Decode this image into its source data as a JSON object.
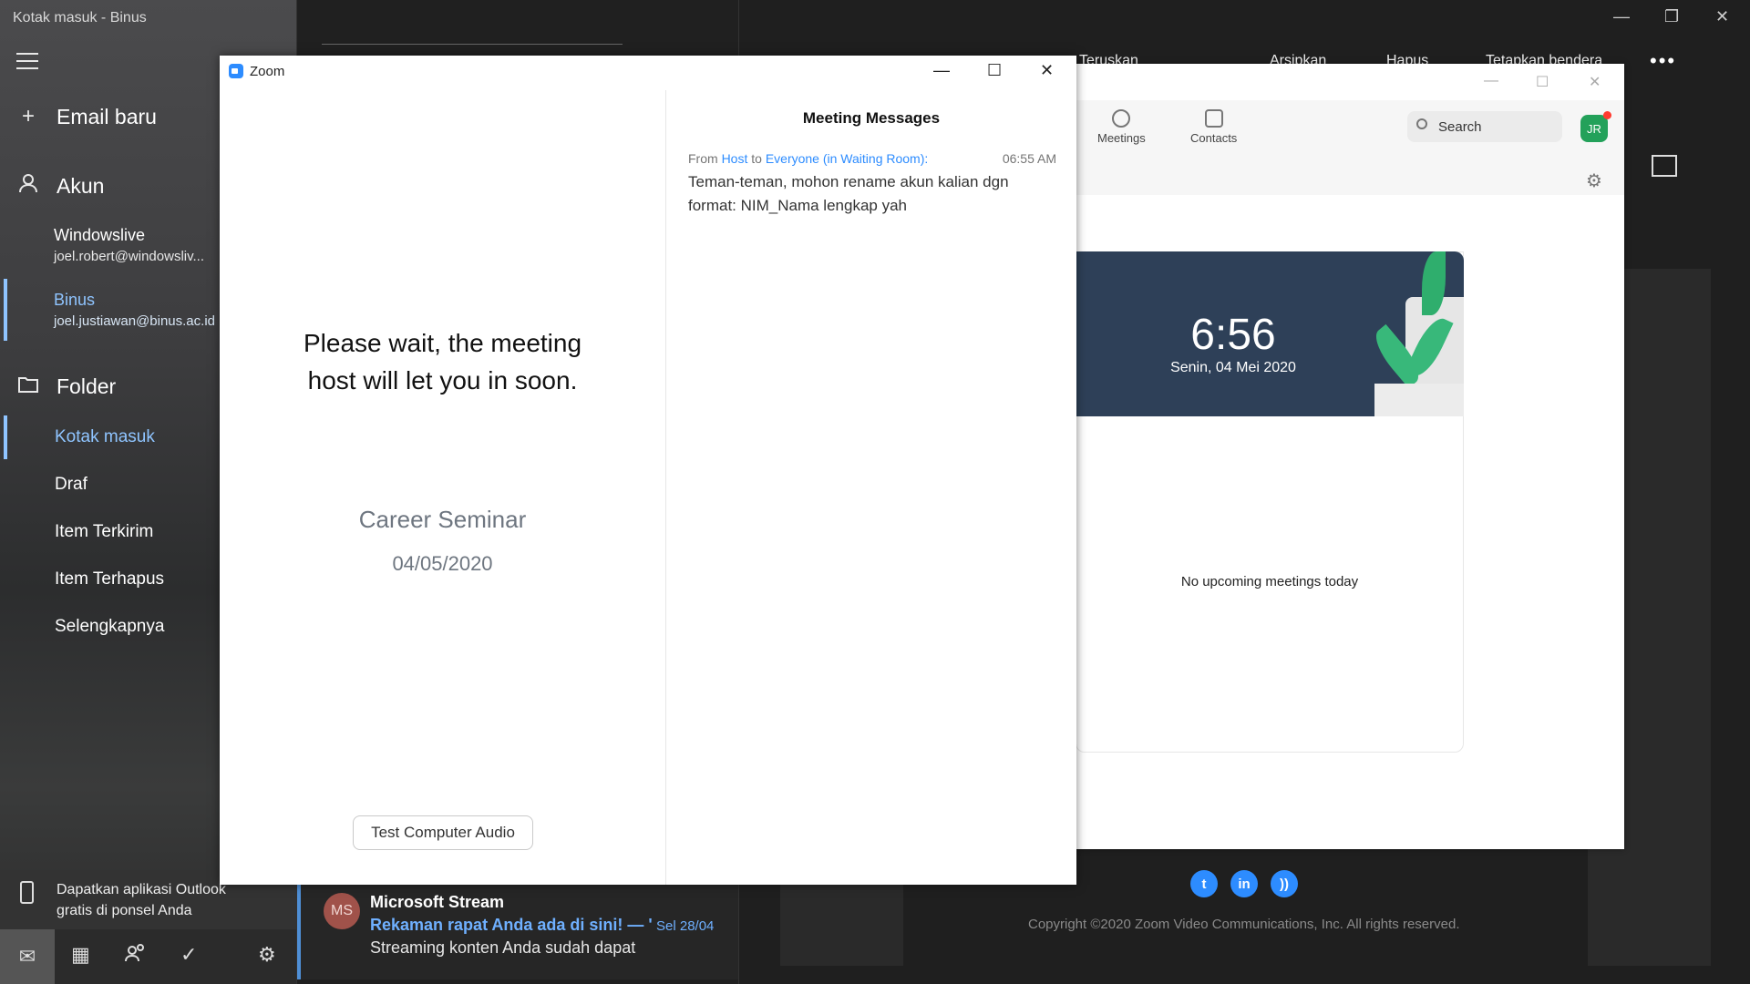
{
  "mail": {
    "window_title": "Kotak masuk - Binus",
    "new_email": "Email baru",
    "accounts_header": "Akun",
    "accounts": [
      {
        "name": "Windowslive",
        "email": "joel.robert@windowsliv..."
      },
      {
        "name": "Binus",
        "email": "joel.justiawan@binus.ac.id"
      }
    ],
    "folders_header": "Folder",
    "folders": [
      "Kotak masuk",
      "Draf",
      "Item Terkirim",
      "Item Terhapus",
      "Selengkapnya"
    ],
    "promo": [
      "Dapatkan aplikasi Outlook",
      "gratis di ponsel Anda"
    ],
    "toolbar": [
      "Teruskan",
      "Arsipkan",
      "Hapus",
      "Tetapkan bendera"
    ],
    "message": {
      "avatar": "MS",
      "from": "Microsoft Stream",
      "subject": "Rekaman rapat Anda ada di sini! — '",
      "date": "Sel 28/04",
      "preview": "Streaming konten Anda sudah dapat"
    }
  },
  "zoom_main": {
    "tabs": [
      "Meetings",
      "Contacts"
    ],
    "search_placeholder": "Search",
    "avatar": "JR",
    "time": "6:56",
    "date": "Senin, 04 Mei 2020",
    "empty_text": "No upcoming meetings today",
    "footer": "Copyright ©2020 Zoom Video Communications, Inc. All rights reserved."
  },
  "zoom_wait": {
    "title": "Zoom",
    "wait_line1": "Please wait, the meeting",
    "wait_line2": "host will let you in soon.",
    "meeting_name": "Career Seminar",
    "meeting_date": "04/05/2020",
    "audio_button": "Test Computer Audio",
    "messages_title": "Meeting Messages",
    "message": {
      "from_label": "From",
      "sender": "Host",
      "to_label": "to",
      "recipient": "Everyone (in Waiting Room):",
      "time": "06:55 AM",
      "text_line1": "Teman-teman, mohon rename akun kalian dgn",
      "text_line2": "format: NIM_Nama lengkap yah"
    }
  }
}
